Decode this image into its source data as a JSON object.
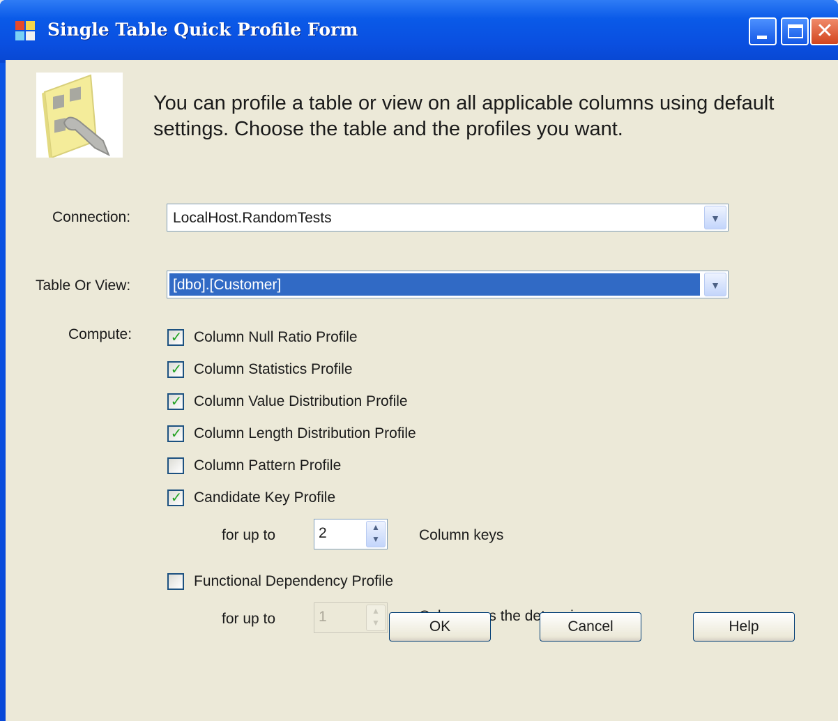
{
  "window": {
    "title": "Single Table Quick Profile Form"
  },
  "header": {
    "description": "You can profile a table or view on all applicable columns using default settings. Choose the table and the profiles you want."
  },
  "connection": {
    "label": "Connection:",
    "value": "LocalHost.RandomTests"
  },
  "table_or_view": {
    "label": "Table Or View:",
    "value": "[dbo].[Customer]"
  },
  "compute": {
    "label": "Compute:",
    "profiles": [
      {
        "label": "Column Null Ratio Profile",
        "checked": true
      },
      {
        "label": "Column Statistics Profile",
        "checked": true
      },
      {
        "label": "Column Value Distribution Profile",
        "checked": true
      },
      {
        "label": "Column Length Distribution Profile",
        "checked": true
      },
      {
        "label": "Column Pattern Profile",
        "checked": false
      },
      {
        "label": "Candidate Key Profile",
        "checked": true
      },
      {
        "label": "Functional Dependency Profile",
        "checked": false
      }
    ],
    "candidate_key": {
      "prefix": "for up to",
      "value": "2",
      "suffix": "Column keys"
    },
    "functional_dependency": {
      "prefix": "for up to",
      "value": "1",
      "suffix": "Columns as the determiner",
      "enabled": false
    }
  },
  "buttons": {
    "ok": "OK",
    "cancel": "Cancel",
    "help": "Help"
  },
  "colors": {
    "titlebar": "#0a5ae8",
    "client": "#ece9d8",
    "selection": "#316ac5",
    "check": "#21a121"
  }
}
